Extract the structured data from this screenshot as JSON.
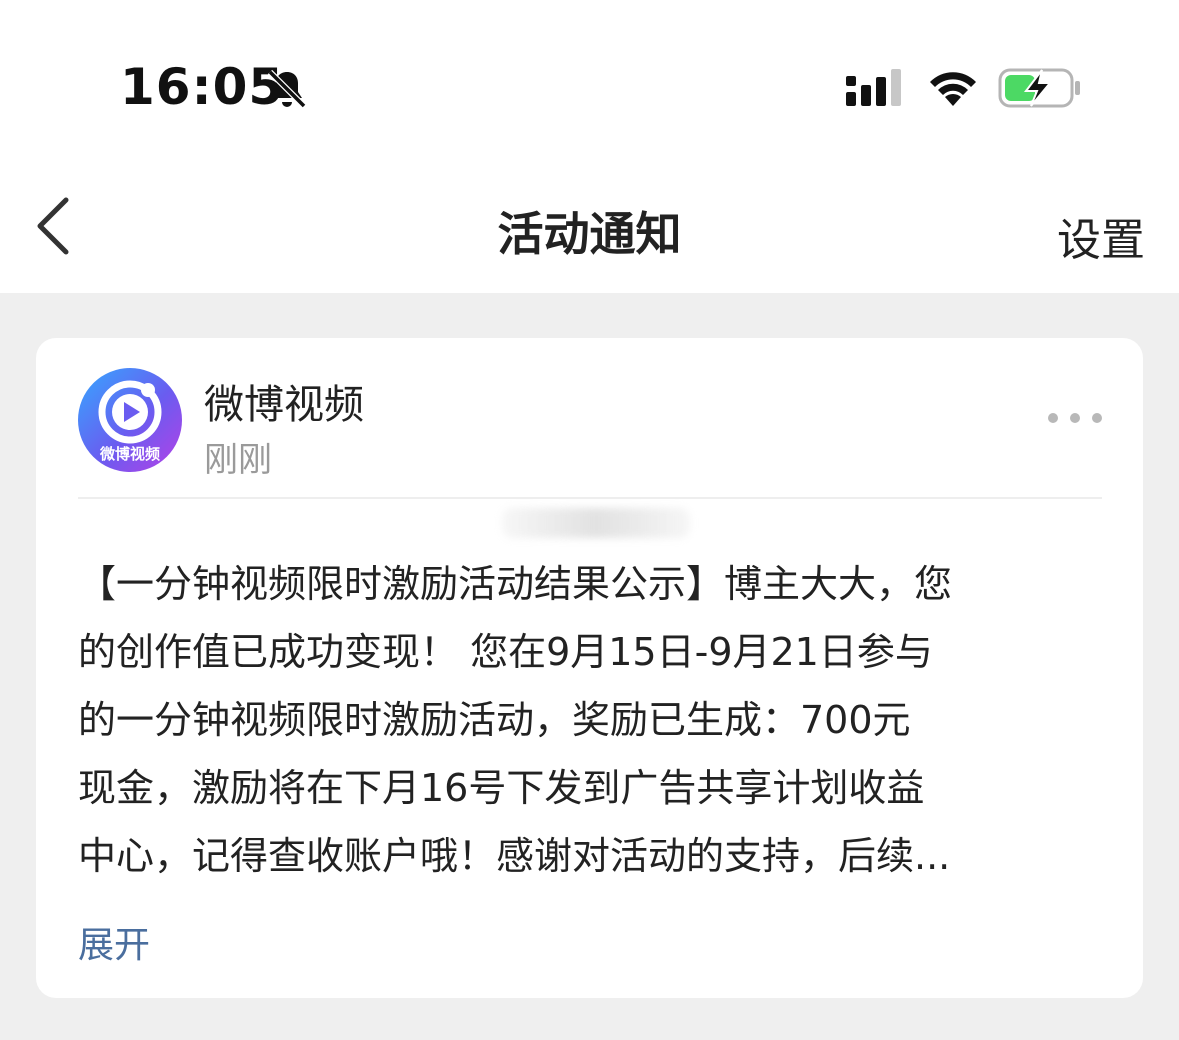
{
  "status_bar": {
    "time": "16:05"
  },
  "nav": {
    "title": "活动通知",
    "settings_label": "设置"
  },
  "notification": {
    "avatar_text": "微博视频",
    "sender": "微博视频",
    "time_ago": "刚刚",
    "message_lines": [
      "【一分钟视频限时激励活动结果公示】博主大大，您",
      "的创作值已成功变现！ 您在9月15日-9月21日参与",
      "的一分钟视频限时激励活动，奖励已生成：700元",
      "现金，激励将在下月16号下发到广告共享计划收益",
      "中心，记得查收账户哦！感谢对活动的支持，后续..."
    ],
    "expand_label": "展开"
  },
  "colors": {
    "battery_fill": "#4cd964",
    "link": "#4a6e9e",
    "muted": "#9a9a9a"
  }
}
